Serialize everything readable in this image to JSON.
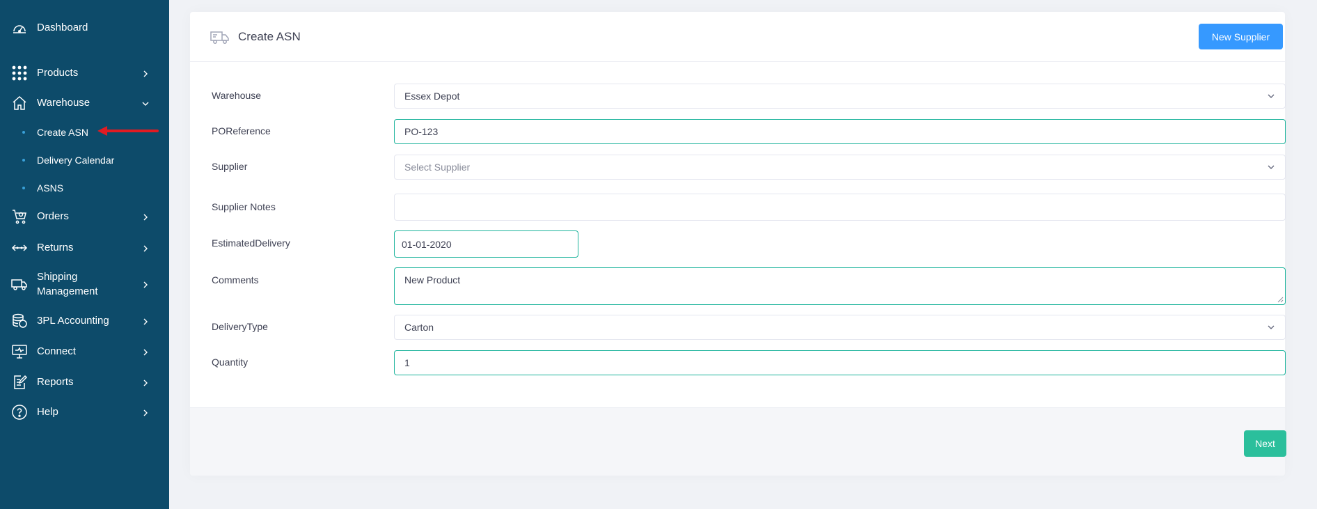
{
  "sidebar": {
    "dashboard": "Dashboard",
    "products": "Products",
    "warehouse": "Warehouse",
    "warehouse_sub": [
      "Create ASN",
      "Delivery Calendar",
      "ASNS"
    ],
    "orders": "Orders",
    "returns": "Returns",
    "shipping_line1": "Shipping",
    "shipping_line2": "Management",
    "accounting": "3PL Accounting",
    "connect": "Connect",
    "reports": "Reports",
    "help": "Help",
    "active_item": "Create ASN"
  },
  "header": {
    "title": "Create ASN",
    "new_supplier_label": "New Supplier"
  },
  "form": {
    "warehouse_label": "Warehouse",
    "warehouse_value": "Essex Depot",
    "po_reference_label": "POReference",
    "po_reference_value": "PO-123",
    "supplier_label": "Supplier",
    "supplier_placeholder": "Select Supplier",
    "supplier_notes_label": "Supplier Notes",
    "supplier_notes_value": "",
    "estimated_delivery_label": "EstimatedDelivery",
    "estimated_delivery_value": "01-01-2020",
    "comments_label": "Comments",
    "comments_value": "New Product",
    "delivery_type_label": "DeliveryType",
    "delivery_type_value": "Carton",
    "quantity_label": "Quantity",
    "quantity_value": "1"
  },
  "footer": {
    "next_label": "Next"
  },
  "colors": {
    "sidebar_bg": "#0d4b6a",
    "primary": "#3699ff",
    "success": "#2bbf9c",
    "annotation_arrow": "#e11b22"
  },
  "icons": {
    "dashboard": "speedometer-icon",
    "products": "grid-dots-icon",
    "warehouse": "home-icon",
    "orders": "shopping-cart-icon",
    "returns": "arrows-horizontal-icon",
    "shipping": "truck-icon",
    "accounting": "coins-icon",
    "connect": "monitor-icon",
    "reports": "clipboard-edit-icon",
    "help": "question-circle-icon",
    "header": "truck-icon"
  }
}
